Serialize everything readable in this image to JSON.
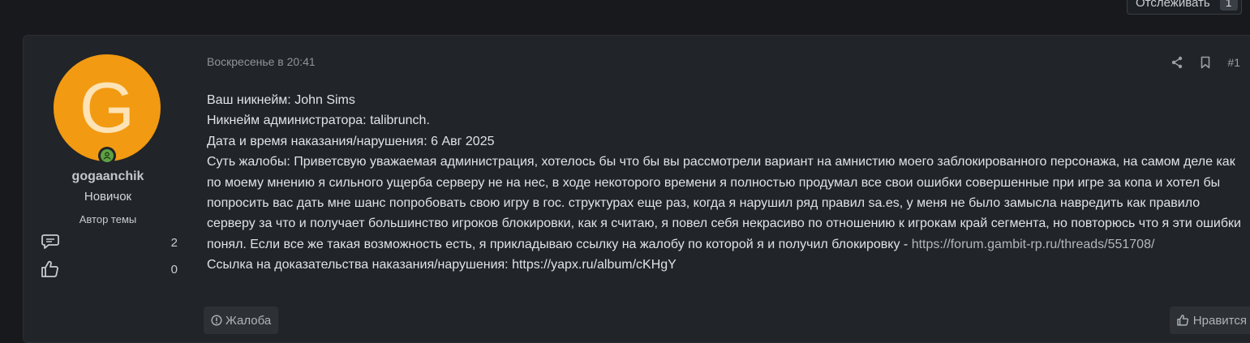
{
  "thread": {
    "watch_label": "Отслеживать",
    "watch_count": "1"
  },
  "post": {
    "author": {
      "initial": "G",
      "username": "gogaanchik",
      "title": "Новичок",
      "badge": "Автор темы",
      "avatar_color": "#f29a11",
      "online_color": "#5da144",
      "messages": "2",
      "reactions": "0"
    },
    "date": "Воскресенье в 20:41",
    "number": "#1",
    "lines": {
      "nickname": "Ваш никнейм: John Sims",
      "admin": "Никнейм администратора: talibrunch.",
      "datetime": "Дата и время наказания/нарушения: 6 Авг 2025",
      "essence": "Суть жалобы: Приветсвую уважаемая администрация, хотелось бы что бы вы рассмотрели вариант на амнистию моего заблокированного персонажа, на самом деле как по моему мнению я сильного ущерба серверу не на нес, в ходе некоторого времени я полностью продумал все свои ошибки совершенные при игре за копа и хотел бы попросить вас дать мне шанс попробовать свою игру в гос. структурах еще раз, когда я нарушил ряд правил sa.es, у меня не было замысла навредить как правило серверу за что и получает большинство игроков блокировки, как я считаю, я повел себя некрасиво по отношению к игрокам край сегмента, но повторюсь что я эти ошибки понял. Если все же такая возможность есть, я прикладываю ссылку на жалобу по которой я и получил блокировку - ",
      "essence_link": "https://forum.gambit-rp.ru/threads/551708/",
      "evidence": "Ссылка на доказательства наказания/нарушения: https://yapx.ru/album/cKHgY"
    },
    "report_label": "Жалоба",
    "like_label": "Нравится"
  },
  "icons": {
    "share": "share-icon",
    "bookmark": "bookmark-icon",
    "messages": "messages-icon",
    "reactions": "thumbs-up-icon",
    "report": "warning-circle-icon",
    "like": "thumbs-up-icon"
  }
}
